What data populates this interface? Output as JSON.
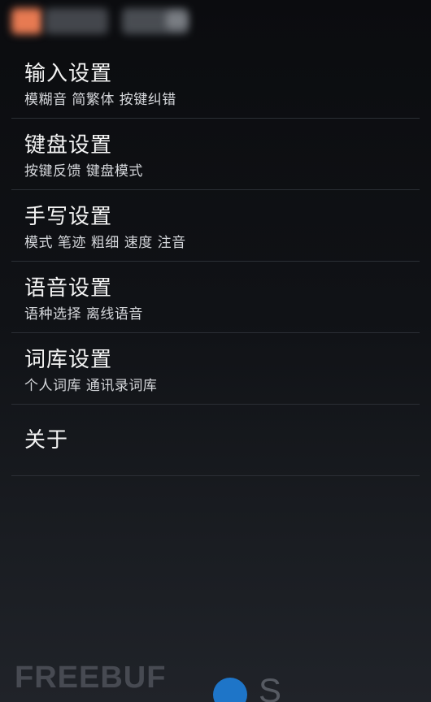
{
  "menu": {
    "items": [
      {
        "title": "输入设置",
        "subtitle": "模糊音 简繁体 按键纠错"
      },
      {
        "title": "键盘设置",
        "subtitle": "按键反馈 键盘模式"
      },
      {
        "title": "手写设置",
        "subtitle": "模式 笔迹 粗细 速度 注音"
      },
      {
        "title": "语音设置",
        "subtitle": "语种选择 离线语音"
      },
      {
        "title": "词库设置",
        "subtitle": "个人词库 通讯录词库"
      },
      {
        "title": "关于"
      }
    ]
  },
  "watermark": {
    "text": "FREEBUF"
  },
  "colors": {
    "background": "#0f1115",
    "divider": "#2b2f35",
    "title_text": "#f4f4f4",
    "subtitle_text": "#d5d7db"
  }
}
